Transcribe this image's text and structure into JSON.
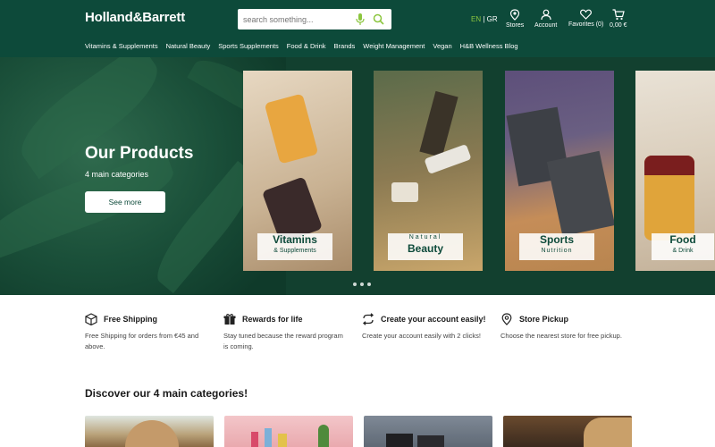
{
  "header": {
    "logo": "Holland&Barrett",
    "search_placeholder": "search something...",
    "lang_en": "EN",
    "lang_sep": " | ",
    "lang_gr": "GR",
    "tools": [
      {
        "label": "Stores",
        "icon": "location-pin-icon"
      },
      {
        "label": "Account",
        "icon": "user-icon"
      },
      {
        "label": "Favorites (0)",
        "icon": "heart-icon"
      },
      {
        "label": "0,00 €",
        "icon": "cart-icon"
      }
    ],
    "nav": [
      "Vitamins & Supplements",
      "Natural Beauty",
      "Sports Supplements",
      "Food & Drink",
      "Brands",
      "Weight Management",
      "Vegan",
      "H&B Wellness Blog"
    ]
  },
  "hero": {
    "title": "Our Products",
    "subtitle": "4 main categories",
    "button": "See more",
    "cards": [
      {
        "line1": "Vitamins",
        "line2": "& Supplements"
      },
      {
        "line1": "Natural",
        "line2": "Beauty"
      },
      {
        "line1": "Sports",
        "line2": "Nutrition"
      },
      {
        "line1": "Food",
        "line2": "& Drink"
      }
    ]
  },
  "features": [
    {
      "title": "Free Shipping",
      "desc": "Free Shipping for orders from €45 and above.",
      "icon": "box-icon"
    },
    {
      "title": "Rewards for life",
      "desc": "Stay tuned because the reward program is coming.",
      "icon": "gift-icon"
    },
    {
      "title": "Create your account easily!",
      "desc": "Create your account easily with 2 clicks!",
      "icon": "sync-arrows-icon"
    },
    {
      "title": "Store Pickup",
      "desc": "Choose the nearest store for free pickup.",
      "icon": "location-pin-icon"
    }
  ],
  "discover_title": "Discover our 4 main categories!",
  "colors": {
    "brand": "#0d4a3a",
    "accent": "#8cc63f"
  }
}
